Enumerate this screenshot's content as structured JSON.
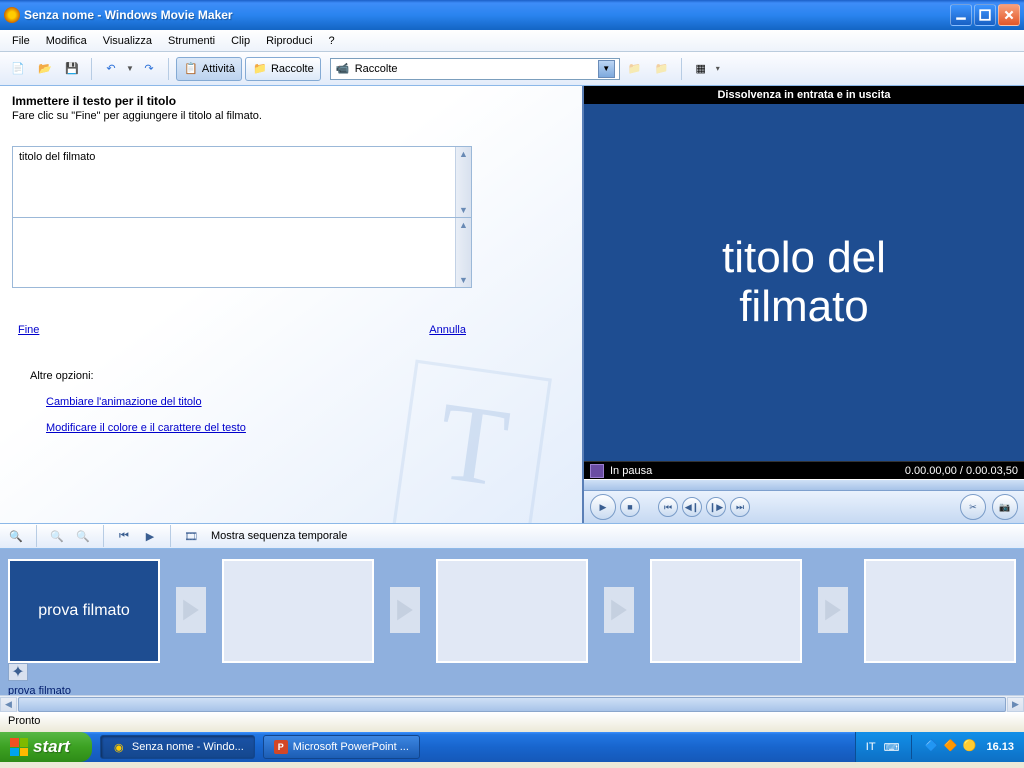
{
  "window": {
    "title": "Senza nome - Windows Movie Maker"
  },
  "menu": {
    "file": "File",
    "modifica": "Modifica",
    "visualizza": "Visualizza",
    "strumenti": "Strumenti",
    "clip": "Clip",
    "riproduci": "Riproduci",
    "help": "?"
  },
  "toolbar": {
    "attivita": "Attività",
    "raccolte": "Raccolte",
    "combo": "Raccolte"
  },
  "task": {
    "heading": "Immettere il testo per il titolo",
    "subtext": "Fare clic su \"Fine\" per aggiungere il titolo al filmato.",
    "input1": "titolo del filmato",
    "fine": "Fine",
    "annulla": "Annulla",
    "altre": "Altre opzioni:",
    "link1": "Cambiare l'animazione del titolo",
    "link2": "Modificare il colore e il carattere del testo"
  },
  "preview": {
    "title": "Dissolvenza in entrata e in uscita",
    "text": "titolo del filmato",
    "status": "In pausa",
    "time": "0.00.00,00 / 0.00.03,50"
  },
  "storybar": {
    "label": "Mostra sequenza temporale"
  },
  "clips": {
    "first_text": "prova filmato",
    "first_label": "prova filmato"
  },
  "status": "Pronto",
  "taskbar": {
    "start": "start",
    "task1": "Senza nome - Windo...",
    "task2": "Microsoft PowerPoint ...",
    "lang": "IT",
    "clock": "16.13"
  }
}
